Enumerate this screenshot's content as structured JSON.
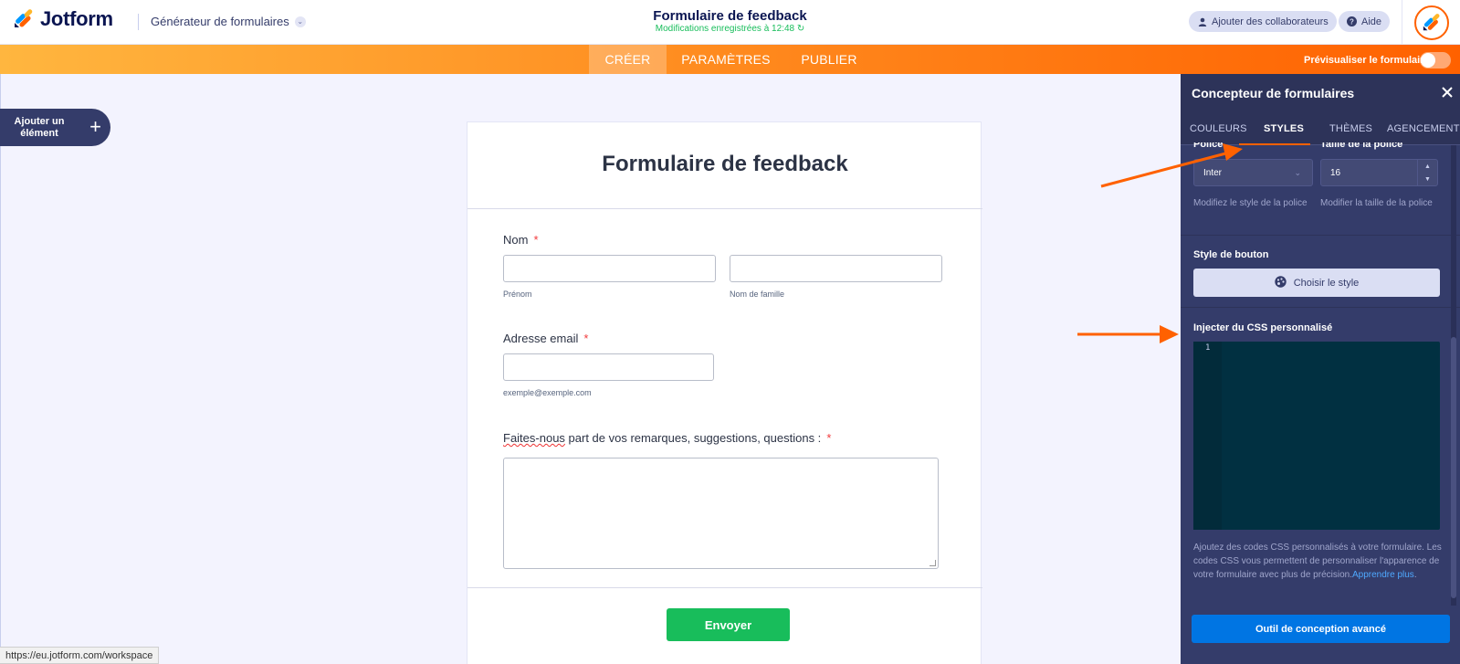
{
  "header": {
    "brand": "Jotform",
    "builder_label": "Générateur de formulaires",
    "form_title": "Formulaire de feedback",
    "saved_status": "Modifications enregistrées à 12:48 ↻",
    "collab_label": "Ajouter des collaborateurs",
    "help_label": "Aide"
  },
  "nav": {
    "tabs": [
      "CRÉER",
      "PARAMÈTRES",
      "PUBLIER"
    ],
    "active_tab": "CRÉER",
    "preview_label": "Prévisualiser le formulaire",
    "preview_enabled": false
  },
  "add_element": {
    "label": "Ajouter un élément",
    "icon": "plus-icon"
  },
  "form": {
    "title": "Formulaire de feedback",
    "name_label": "Nom",
    "required_mark": "*",
    "first_name_sublabel": "Prénom",
    "last_name_sublabel": "Nom de famille",
    "email_label": "Adresse email",
    "email_sublabel": "exemple@exemple.com",
    "feedback_label_word": "Faites-nous",
    "feedback_label_rest": " part de vos remarques, suggestions, questions :",
    "submit_label": "Envoyer"
  },
  "panel": {
    "title": "Concepteur de formulaires",
    "tabs": [
      "COULEURS",
      "STYLES",
      "THÈMES",
      "AGENCEMENT"
    ],
    "active_tab": "STYLES",
    "font_label": "Police",
    "font_size_label": "Taille de la police",
    "font_value": "Inter",
    "font_size_value": "16",
    "font_hint": "Modifiez le style de la police",
    "font_size_hint": "Modifier la taille de la police",
    "button_style_label": "Style de bouton",
    "choose_style_label": "Choisir le style",
    "css_label": "Injecter du CSS personnalisé",
    "css_line_number": "1",
    "css_help": "Ajoutez des codes CSS personnalisés à votre formulaire. Les codes CSS vous permettent de personnaliser l'apparence de votre formulaire avec plus de précision.",
    "learn_more": "Apprendre plus",
    "learn_more_suffix": ".",
    "advanced_button": "Outil de conception avancé"
  },
  "status_bar": {
    "url": "https://eu.jotform.com/workspace"
  },
  "colors": {
    "brand_navy": "#0a1551",
    "accent_orange": "#ff6100",
    "submit_green": "#18bd5b",
    "panel_bg": "#343c6a",
    "advanced_blue": "#0075e3",
    "required_red": "#f23a3c"
  }
}
